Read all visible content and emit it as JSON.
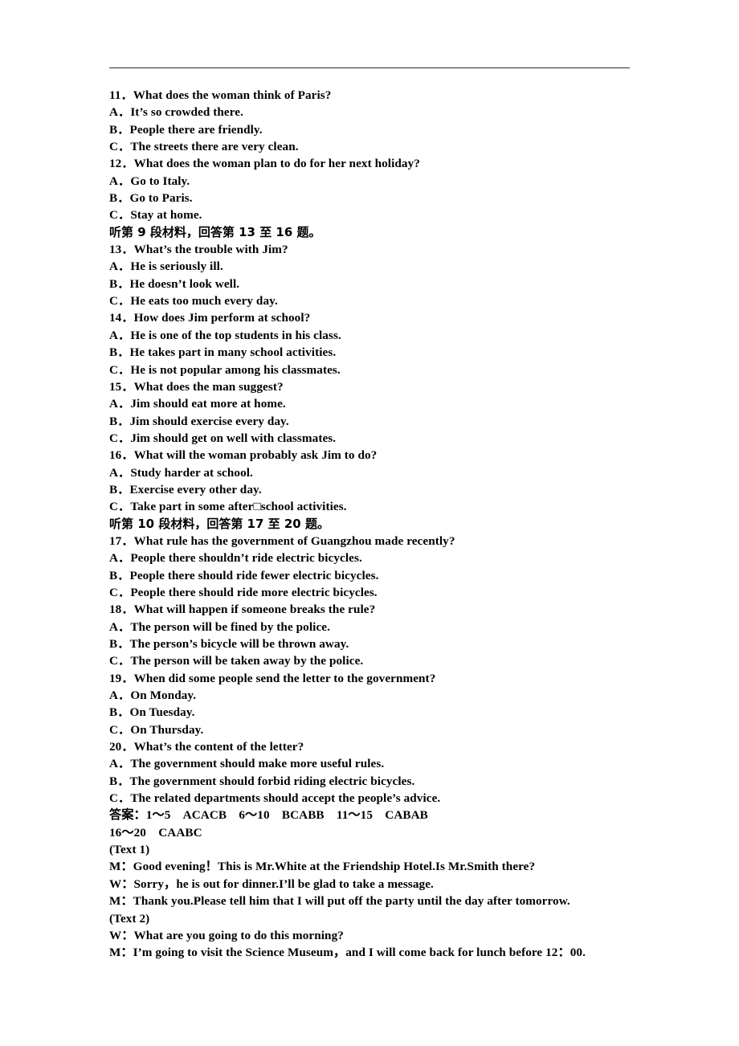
{
  "document": {
    "type": "exam-paper-listening-section",
    "header_rule": true,
    "lines": [
      {
        "id": "q11",
        "kind": "question",
        "text": "11．What does the woman think of Paris?"
      },
      {
        "id": "q11a",
        "kind": "option",
        "text": "A．It’s so crowded there."
      },
      {
        "id": "q11b",
        "kind": "option",
        "text": "B．People there are friendly."
      },
      {
        "id": "q11c",
        "kind": "option",
        "text": "C．The streets there are very clean."
      },
      {
        "id": "q12",
        "kind": "question",
        "text": "12．What does the woman plan to do for her next holiday?"
      },
      {
        "id": "q12a",
        "kind": "option",
        "text": "A．Go to Italy."
      },
      {
        "id": "q12b",
        "kind": "option",
        "text": "B．Go to Paris."
      },
      {
        "id": "q12c",
        "kind": "option",
        "text": "C．Stay at home."
      },
      {
        "id": "instr-9",
        "kind": "cjk",
        "text": "听第 9 段材料，回答第 13 至 16 题。"
      },
      {
        "id": "q13",
        "kind": "question",
        "text": "13．What’s the trouble with Jim?"
      },
      {
        "id": "q13a",
        "kind": "option",
        "text": "A．He is seriously ill."
      },
      {
        "id": "q13b",
        "kind": "option",
        "text": "B．He doesn’t look well."
      },
      {
        "id": "q13c",
        "kind": "option",
        "text": "C．He eats too much every day."
      },
      {
        "id": "q14",
        "kind": "question",
        "text": "14．How does Jim perform at school?"
      },
      {
        "id": "q14a",
        "kind": "option",
        "text": "A．He is one of the top students in his class."
      },
      {
        "id": "q14b",
        "kind": "option",
        "text": "B．He takes part in many school activities."
      },
      {
        "id": "q14c",
        "kind": "option",
        "text": "C．He is not popular among his classmates."
      },
      {
        "id": "q15",
        "kind": "question",
        "text": "15．What does the man suggest?"
      },
      {
        "id": "q15a",
        "kind": "option",
        "text": "A．Jim should eat more at home."
      },
      {
        "id": "q15b",
        "kind": "option",
        "text": "B．Jim should exercise every day."
      },
      {
        "id": "q15c",
        "kind": "option",
        "text": "C．Jim should get on well with classmates."
      },
      {
        "id": "q16",
        "kind": "question",
        "text": "16．What will the woman probably ask Jim to do?"
      },
      {
        "id": "q16a",
        "kind": "option",
        "text": "A．Study harder at school."
      },
      {
        "id": "q16b",
        "kind": "option",
        "text": "B．Exercise every other day."
      },
      {
        "id": "q16c",
        "kind": "option",
        "text": "C．Take part in some after□school activities."
      },
      {
        "id": "instr-10",
        "kind": "cjk",
        "text": "听第 10 段材料，回答第 17 至 20 题。"
      },
      {
        "id": "q17",
        "kind": "question",
        "text": "17．What rule has the government of Guangzhou made recently?"
      },
      {
        "id": "q17a",
        "kind": "option",
        "text": "A．People there shouldn’t ride electric bicycles."
      },
      {
        "id": "q17b",
        "kind": "option",
        "text": "B．People there should ride fewer electric bicycles."
      },
      {
        "id": "q17c",
        "kind": "option",
        "text": "C．People there should ride more electric bicycles."
      },
      {
        "id": "q18",
        "kind": "question",
        "text": "18．What will happen if someone breaks the rule?"
      },
      {
        "id": "q18a",
        "kind": "option",
        "text": "A．The person will be fined by the police."
      },
      {
        "id": "q18b",
        "kind": "option",
        "text": "B．The person’s bicycle will be thrown away."
      },
      {
        "id": "q18c",
        "kind": "option",
        "text": "C．The person will be taken away by the police."
      },
      {
        "id": "q19",
        "kind": "question",
        "text": "19．When did some people send the letter to the government?"
      },
      {
        "id": "q19a",
        "kind": "option",
        "text": "A．On Monday."
      },
      {
        "id": "q19b",
        "kind": "option",
        "text": "B．On Tuesday."
      },
      {
        "id": "q19c",
        "kind": "option",
        "text": "C．On Thursday."
      },
      {
        "id": "q20",
        "kind": "question",
        "text": "20．What’s the content of the letter?"
      },
      {
        "id": "q20a",
        "kind": "option",
        "text": "A．The government should make more useful rules."
      },
      {
        "id": "q20b",
        "kind": "option",
        "text": "B．The government should forbid riding electric bicycles."
      },
      {
        "id": "q20c",
        "kind": "option",
        "text": "C．The related departments should accept the people’s advice."
      },
      {
        "id": "answers-1",
        "kind": "answer",
        "text": "答案：1～5　ACACB　6～10　BCABB　11～15　CABAB"
      },
      {
        "id": "answers-2",
        "kind": "answer",
        "text": "16～20　CAABC"
      },
      {
        "id": "text1-head",
        "kind": "script",
        "text": "(Text 1)"
      },
      {
        "id": "text1-m1",
        "kind": "script",
        "text": "M：Good evening！This is Mr.White at the Friendship Hotel.Is Mr.Smith there?"
      },
      {
        "id": "text1-w1",
        "kind": "script",
        "text": "W：Sorry，he is out for dinner.I’ll be glad to take a message."
      },
      {
        "id": "text1-m2",
        "kind": "script",
        "text": "M：Thank you.Please tell him that I will put off the party until the day after tomorrow."
      },
      {
        "id": "text2-head",
        "kind": "script",
        "text": "(Text 2)"
      },
      {
        "id": "text2-w1",
        "kind": "script",
        "text": "W：What are you going to do this morning?"
      },
      {
        "id": "text2-m1",
        "kind": "script",
        "text": "M：I’m going to visit the Science Museum，and I will come back for lunch before 12：00."
      }
    ]
  }
}
